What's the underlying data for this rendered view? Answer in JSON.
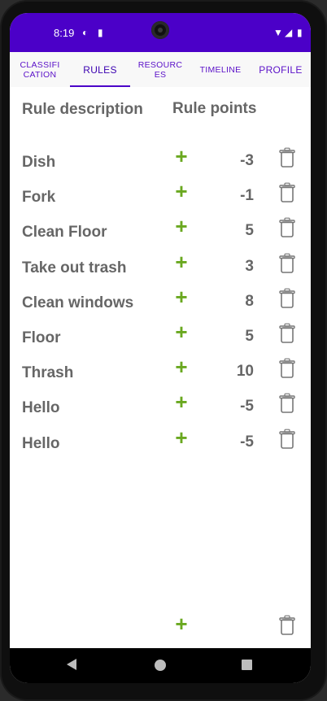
{
  "status": {
    "time": "8:19"
  },
  "tabs": [
    {
      "label": "CLASSIFI\nCATION"
    },
    {
      "label": "RULES"
    },
    {
      "label": "RESOURC\nES"
    },
    {
      "label": "TIMELINE"
    },
    {
      "label": "PROFILE"
    }
  ],
  "header": {
    "description": "Rule description",
    "points": "Rule points"
  },
  "rules": [
    {
      "description": "Dish",
      "points": "-3"
    },
    {
      "description": "Fork",
      "points": "-1"
    },
    {
      "description": "Clean Floor",
      "points": "5"
    },
    {
      "description": "Take out trash",
      "points": "3"
    },
    {
      "description": "Clean windows",
      "points": "8"
    },
    {
      "description": "Floor",
      "points": "5"
    },
    {
      "description": "Thrash",
      "points": "10"
    },
    {
      "description": "Hello",
      "points": "-5"
    },
    {
      "description": "Hello",
      "points": "-5"
    }
  ],
  "icons": {
    "add": "plus-icon",
    "delete": "trash-icon"
  },
  "colors": {
    "statusbar": "#4b00c8",
    "accent": "#6aa820",
    "tab_text": "#5a10c8"
  }
}
